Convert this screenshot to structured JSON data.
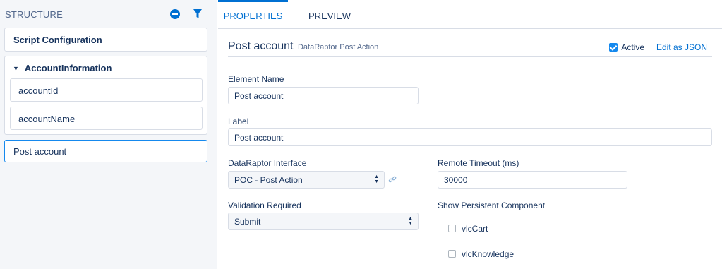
{
  "sidebar": {
    "title": "STRUCTURE",
    "script_config": "Script Configuration",
    "block": {
      "title": "AccountInformation",
      "items": [
        {
          "label": "accountId"
        },
        {
          "label": "accountName"
        }
      ]
    },
    "selected_item": "Post account"
  },
  "tabs": [
    {
      "label": "PROPERTIES",
      "active": true
    },
    {
      "label": "PREVIEW",
      "active": false
    }
  ],
  "element": {
    "title": "Post account",
    "type": "DataRaptor Post Action",
    "active_label": "Active",
    "active_checked": true,
    "edit_json_label": "Edit as JSON"
  },
  "form": {
    "element_name": {
      "label": "Element Name",
      "value": "Post account"
    },
    "label": {
      "label": "Label",
      "value": "Post account"
    },
    "dataraptor_interface": {
      "label": "DataRaptor Interface",
      "value": "POC - Post Action"
    },
    "remote_timeout": {
      "label": "Remote Timeout (ms)",
      "value": "30000"
    },
    "validation_required": {
      "label": "Validation Required",
      "value": "Submit"
    },
    "persistent_component": {
      "label": "Show Persistent Component",
      "options": [
        {
          "label": "vlcCart",
          "checked": false
        },
        {
          "label": "vlcKnowledge",
          "checked": false
        }
      ]
    }
  },
  "colors": {
    "accent": "#0070d2",
    "text": "#16325c",
    "border": "#d8dde6",
    "panel_bg": "#f4f6f9"
  },
  "icons": {
    "collapse": "minus-circle-icon",
    "filter": "filter-icon",
    "link": "link-icon",
    "caret": "caret-down-icon"
  }
}
